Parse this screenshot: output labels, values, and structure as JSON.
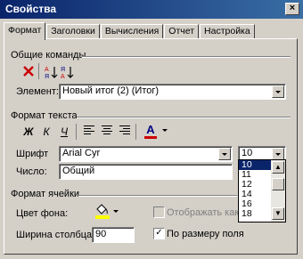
{
  "window": {
    "title": "Свойства",
    "close_glyph": "×"
  },
  "tabs": [
    "Формат",
    "Заголовки",
    "Вычисления",
    "Отчет",
    "Настройка"
  ],
  "common": {
    "group_label": "Общие команды",
    "element_label": "Элемент:",
    "element_value": "Новый итог (2) (Итог)"
  },
  "text_format": {
    "group_label": "Формат текста",
    "bold": "Ж",
    "italic": "К",
    "underline": "Ч",
    "font_color_glyph": "A",
    "font_color": "#cc0000",
    "font_label": "Шрифт",
    "font_value": "Arial Cyr",
    "size_value": "10",
    "size_options": [
      "10",
      "11",
      "12",
      "14",
      "16",
      "18"
    ],
    "number_label": "Число:",
    "number_value": "Общий"
  },
  "cell_format": {
    "group_label": "Формат ячейки",
    "bg_label": "Цвет фона:",
    "fill_color": "#ffff00",
    "width_label": "Ширина столбца:",
    "width_value": "90",
    "show_as_label": "Отображать как",
    "autofit_label": "По размеру поля",
    "autofit_checked": "✓"
  },
  "colors": {
    "accent": "#0a246a",
    "face": "#d4d0c8"
  }
}
